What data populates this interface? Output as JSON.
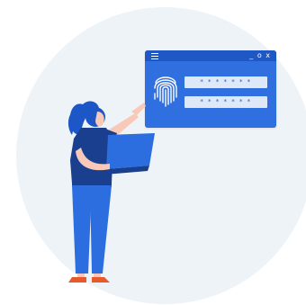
{
  "login_window": {
    "controls": "_ o x",
    "password_fields": [
      "* * * * * * *",
      "* * * * * * *"
    ]
  },
  "icons": [
    "menu-icon",
    "fingerprint-icon"
  ],
  "colors": {
    "background_circle": "#eef3f8",
    "window_blue": "#2f6fe0",
    "titlebar_blue": "#1f58c4",
    "field_fill": "#dfe8f7",
    "hair_blue": "#1d56c7",
    "shirt_navy": "#1a3f8f",
    "pants_blue": "#2c6de0",
    "skin": "#f8c9b8",
    "shoes": "#e85a2a"
  }
}
